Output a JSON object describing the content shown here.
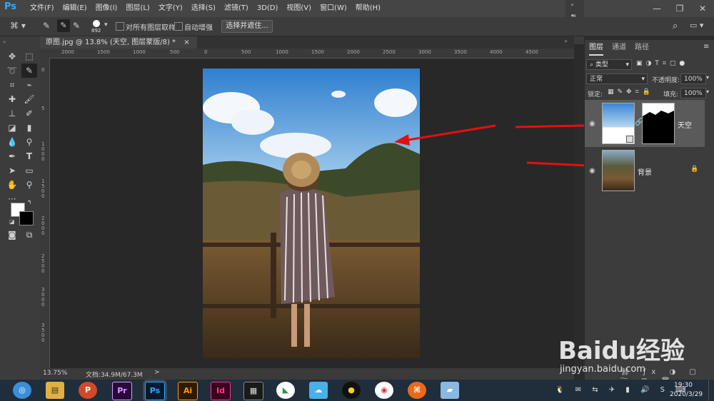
{
  "app": {
    "logo": "Ps",
    "menu": [
      "文件(F)",
      "编辑(E)",
      "图像(I)",
      "图层(L)",
      "文字(Y)",
      "选择(S)",
      "滤镜(T)",
      "3D(D)",
      "视图(V)",
      "窗口(W)",
      "帮助(H)"
    ],
    "window_controls": [
      "minimize-icon",
      "restore-icon",
      "close-icon"
    ]
  },
  "options": {
    "brush_size": "892",
    "sample_all_layers": "对所有图层取样",
    "auto_enhance": "自动增强",
    "refine_button": "选择并遮住..."
  },
  "document": {
    "tab_title": "原图.jpg @ 13.8% (天空, 图层蒙版/8) *",
    "tab_close": "×"
  },
  "rulers": {
    "top": [
      "2000",
      "1500",
      "1000",
      "500",
      "0",
      "500",
      "1000",
      "1500",
      "2000",
      "2500",
      "3000",
      "3500",
      "4000",
      "4500"
    ],
    "left": [
      "0",
      "5",
      "1000",
      "1500",
      "2000",
      "2500",
      "3000",
      "3500"
    ]
  },
  "status": {
    "zoom": "13.75%",
    "doc_size": "文档:34.9M/67.3M"
  },
  "panel": {
    "tabs": [
      "图层",
      "通道",
      "路径"
    ],
    "filter_kind": "类型",
    "blend_mode": "正常",
    "opacity_label": "不透明度:",
    "opacity_value": "100%",
    "lock_label": "锁定:",
    "fill_label": "填充:",
    "fill_value": "100%",
    "layers": [
      {
        "name": "天空",
        "has_mask": true
      },
      {
        "name": "背景",
        "locked": true
      }
    ]
  },
  "taskbar": {
    "time": "19:30",
    "date": "2020/3/29",
    "apps": [
      "Pr",
      "Ps",
      "Ai",
      "Id"
    ]
  },
  "watermark": {
    "brand": "Baidu经验",
    "url": "jingyan.baidu.com"
  },
  "colors": {
    "ps_blue": "#31a8ff",
    "arrow_red": "#e41010",
    "panel_bg": "#3c3c3c"
  }
}
